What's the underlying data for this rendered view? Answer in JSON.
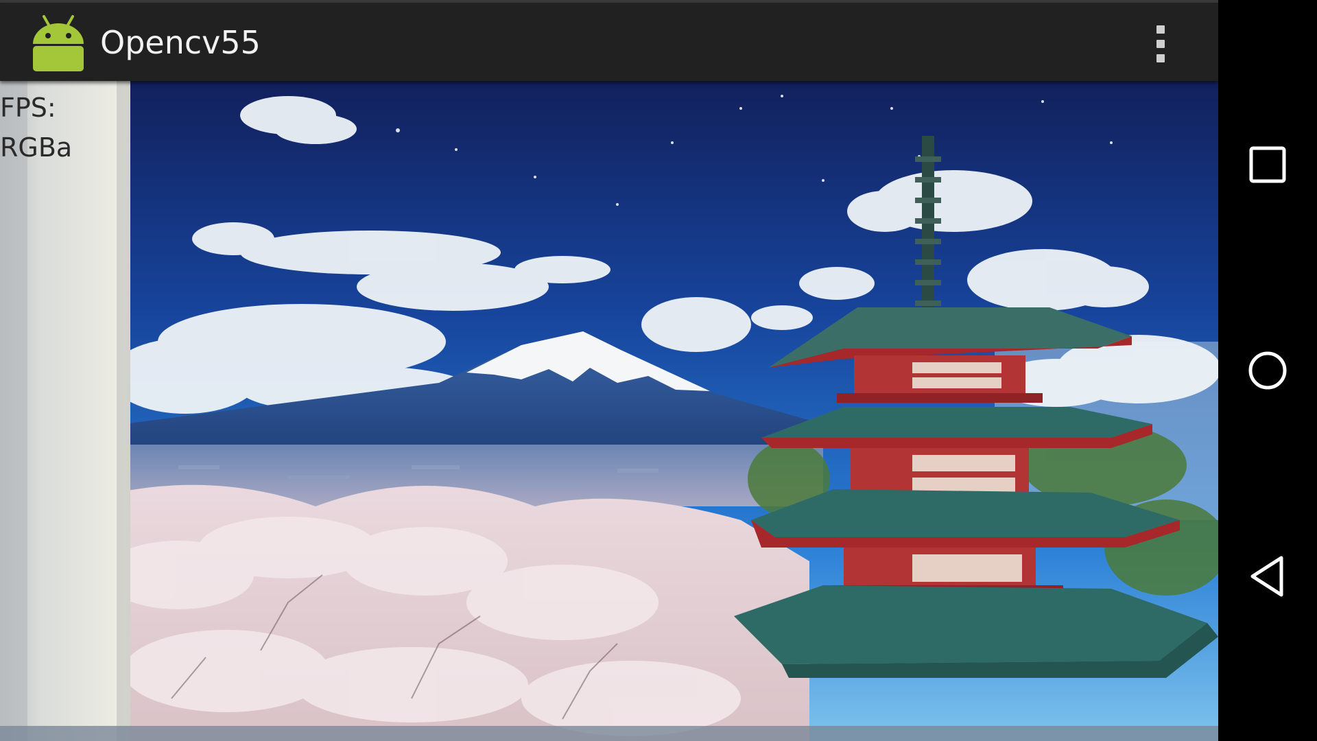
{
  "app": {
    "title": "Opencv55",
    "icon": "android-robot-icon"
  },
  "action_bar": {
    "overflow_icon": "more-vert-icon"
  },
  "camera": {
    "fps_label": "FPS:",
    "color_mode": "RGBa"
  },
  "nav_bar": {
    "recents_icon": "square-icon",
    "home_icon": "circle-icon",
    "back_icon": "triangle-back-icon"
  },
  "colors": {
    "action_bar": "#212121",
    "android_green": "#a4c639",
    "sky_blue": "#1f5fbf",
    "pagoda_red": "#a6282a",
    "roof_teal": "#2f6b66"
  }
}
